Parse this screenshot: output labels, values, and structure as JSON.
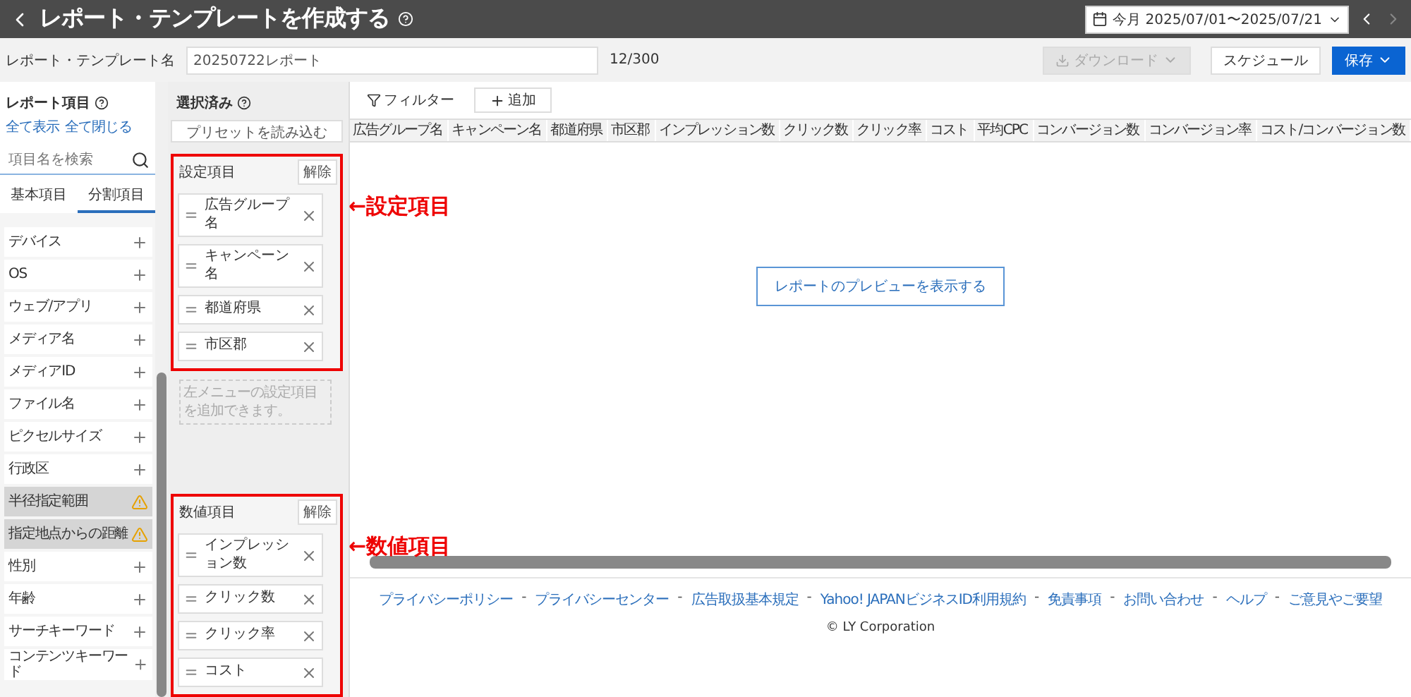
{
  "header": {
    "title": "レポート・テンプレートを作成する",
    "date_range": "今月 2025/07/01〜2025/07/21"
  },
  "name_row": {
    "label": "レポート・テンプレート名",
    "value": "20250722レポート",
    "counter": "12/300",
    "buttons": [
      {
        "label": "ダウンロード",
        "kind": "download",
        "disabled": true
      },
      {
        "label": "スケジュール",
        "kind": "plain",
        "disabled": false
      },
      {
        "label": "保存",
        "kind": "primary",
        "disabled": false
      }
    ]
  },
  "report_items": {
    "title": "レポート項目",
    "links": [
      "全て表示",
      "全て閉じる"
    ],
    "search_placeholder": "項目名を検索",
    "tabs": [
      {
        "label": "基本項目",
        "selected": false
      },
      {
        "label": "分割項目",
        "selected": true
      }
    ],
    "items": [
      {
        "label": "デバイス",
        "kind": "add"
      },
      {
        "label": "OS",
        "kind": "add"
      },
      {
        "label": "ウェブ/アプリ",
        "kind": "add"
      },
      {
        "label": "メディア名",
        "kind": "add"
      },
      {
        "label": "メディアID",
        "kind": "add"
      },
      {
        "label": "ファイル名",
        "kind": "add"
      },
      {
        "label": "ピクセルサイズ",
        "kind": "add"
      },
      {
        "label": "行政区",
        "kind": "add"
      },
      {
        "label": "半径指定範囲",
        "kind": "warning"
      },
      {
        "label": "指定地点からの距離",
        "kind": "warning"
      },
      {
        "label": "性別",
        "kind": "add"
      },
      {
        "label": "年齢",
        "kind": "add"
      },
      {
        "label": "サーチキーワード",
        "kind": "add"
      },
      {
        "label": "コンテンツキーワード",
        "kind": "add"
      }
    ]
  },
  "selected": {
    "title": "選択済み",
    "preset_button": "プリセットを読み込む",
    "sections": [
      {
        "title": "設定項目",
        "clear": "解除",
        "items": [
          "広告グループ名",
          "キャンペーン名",
          "都道府県",
          "市区郡"
        ],
        "hint": "左メニューの設定項目を追加できます。",
        "annotation": "←設定項目"
      },
      {
        "title": "数値項目",
        "clear": "解除",
        "items": [
          "インプレッション数",
          "クリック数",
          "クリック率",
          "コスト"
        ],
        "annotation": "←数値項目"
      }
    ]
  },
  "preview": {
    "filter": "フィルター",
    "add": "追加",
    "columns": [
      "広告グループ名",
      "キャンペーン名",
      "都道府県",
      "市区郡",
      "インプレッション数",
      "クリック数",
      "クリック率",
      "コスト",
      "平均CPC",
      "コンバージョン数",
      "コンバージョン率",
      "コスト/コンバージョン数"
    ],
    "preview_button": "レポートのプレビューを表示する"
  },
  "footer": {
    "links": [
      "プライバシーポリシー",
      "プライバシーセンター",
      "広告取扱基本規定",
      "Yahoo! JAPANビジネスID利用規約",
      "免責事項",
      "お問い合わせ",
      "ヘルプ",
      "ご意見やご要望"
    ],
    "separator": "-",
    "copyright": "© LY Corporation"
  }
}
